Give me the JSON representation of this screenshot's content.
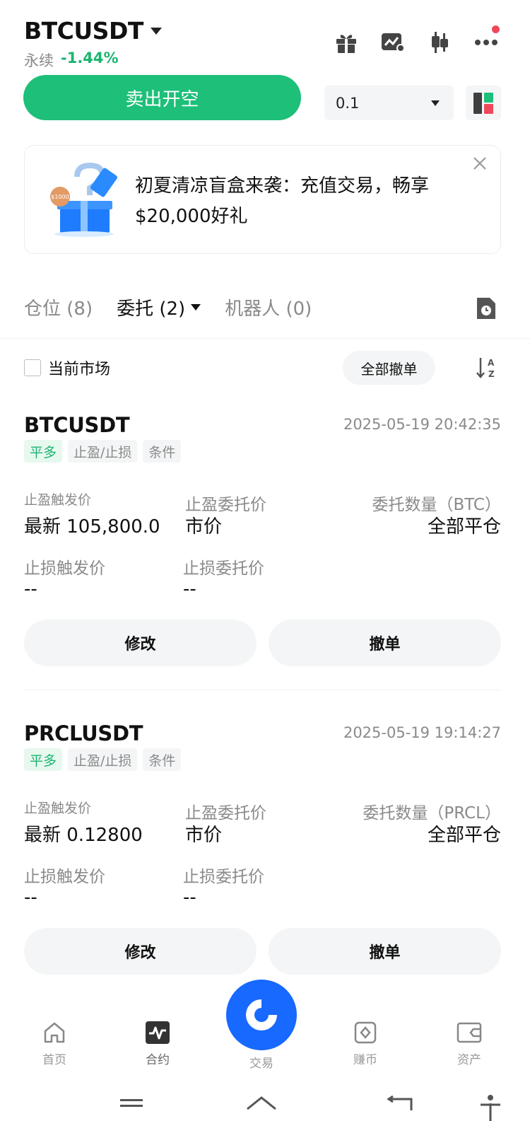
{
  "header": {
    "symbol": "BTCUSDT",
    "contract_type": "永续",
    "change": "-1.44%"
  },
  "trade_bar": {
    "sell_label": "卖出开空",
    "quantity": "0.1"
  },
  "banner": {
    "text": "初夏清凉盲盒来袭：充值交易，畅享$20,000好礼",
    "coin_text": "$1000"
  },
  "tabs": [
    {
      "label": "仓位 (8)"
    },
    {
      "label": "委托 (2)"
    },
    {
      "label": "机器人 (0)"
    }
  ],
  "filter": {
    "current_market_label": "当前市场",
    "cancel_all_label": "全部撤单"
  },
  "orders": [
    {
      "pair": "BTCUSDT",
      "time": "2025-05-19 20:42:35",
      "tags": [
        "平多",
        "止盈/止损",
        "条件"
      ],
      "tp_trigger_label": "止盈触发价",
      "tp_trigger_value": "最新 105,800.0",
      "tp_price_label": "止盈委托价",
      "tp_price_value": "市价",
      "qty_label": "委托数量（BTC）",
      "qty_value": "全部平仓",
      "sl_trigger_label": "止损触发价",
      "sl_trigger_value": "--",
      "sl_price_label": "止损委托价",
      "sl_price_value": "--",
      "modify_label": "修改",
      "cancel_label": "撤单"
    },
    {
      "pair": "PRCLUSDT",
      "time": "2025-05-19 19:14:27",
      "tags": [
        "平多",
        "止盈/止损",
        "条件"
      ],
      "tp_trigger_label": "止盈触发价",
      "tp_trigger_value": "最新 0.12800",
      "tp_price_label": "止盈委托价",
      "tp_price_value": "市价",
      "qty_label": "委托数量（PRCL）",
      "qty_value": "全部平仓",
      "sl_trigger_label": "止损触发价",
      "sl_trigger_value": "--",
      "sl_price_label": "止损委托价",
      "sl_price_value": "--",
      "modify_label": "修改",
      "cancel_label": "撤单"
    }
  ],
  "bottom_nav": [
    {
      "label": "首页",
      "icon": "home-icon"
    },
    {
      "label": "合约",
      "icon": "contract-chart-icon"
    },
    {
      "label": "交易",
      "icon": "trade-logo-icon"
    },
    {
      "label": "赚币",
      "icon": "earn-icon"
    },
    {
      "label": "资产",
      "icon": "wallet-icon"
    }
  ],
  "colors": {
    "green": "#1dbf79",
    "red": "#f0485b",
    "brand_blue": "#1769ff"
  }
}
